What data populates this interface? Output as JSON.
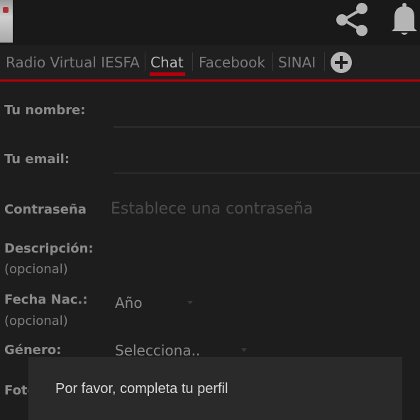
{
  "appbar": {
    "share_icon": "share-icon",
    "bell_icon": "bell-icon"
  },
  "tabs": [
    {
      "label": "Radio Virtual IESFA",
      "active": false
    },
    {
      "label": "Chat",
      "active": true
    },
    {
      "label": "Facebook",
      "active": false
    },
    {
      "label": "SINAI",
      "active": false
    }
  ],
  "add_tab_icon": "plus-circle-icon",
  "form": {
    "name_label": "Tu nombre:",
    "email_label": "Tu email:",
    "password_label": "Contraseña",
    "password_placeholder": "Establece una contraseña",
    "description_label": "Descripción:",
    "description_optional": "(opcional)",
    "birth_label": "Fecha Nac.:",
    "birth_optional": "(opcional)",
    "year_value": "Año",
    "gender_label": "Género:",
    "gender_value": "Selecciona..",
    "photo_label": "Foto"
  },
  "toast": {
    "message": "Por favor, completa tu perfil"
  },
  "colors": {
    "accent": "#b3000c",
    "background": "#1d1d1d"
  }
}
